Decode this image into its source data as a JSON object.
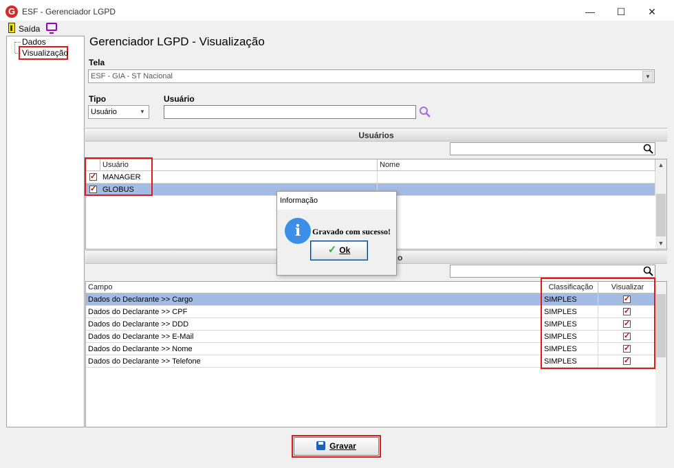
{
  "window": {
    "title": "ESF - Gerenciador LGPD",
    "logo_letter": "G",
    "minimize": "—",
    "maximize": "☐",
    "close": "✕"
  },
  "toolbar": {
    "exit_label": "Saída"
  },
  "tree": {
    "items": [
      {
        "label": "Dados"
      },
      {
        "label": "Visualização"
      }
    ]
  },
  "page": {
    "title": "Gerenciador LGPD - Visualização"
  },
  "tela": {
    "label": "Tela",
    "value": "ESF - GIA - ST Nacional"
  },
  "tipo": {
    "label": "Tipo",
    "value": "Usuário"
  },
  "usuario": {
    "label": "Usuário",
    "value": ""
  },
  "usuarios_section": {
    "title": "Usuários",
    "columns": [
      "Usuário",
      "Nome"
    ],
    "rows": [
      {
        "usuario": "MANAGER",
        "nome": "",
        "checked": true
      },
      {
        "usuario": "GLOBUS",
        "nome": "",
        "checked": true,
        "selected": true
      }
    ]
  },
  "campos_section": {
    "title": "o",
    "columns": [
      "Campo",
      "Classificação",
      "Visualizar"
    ],
    "rows": [
      {
        "campo": "Dados do Declarante >> Cargo",
        "classificacao": "SIMPLES",
        "visualizar": true,
        "selected": true
      },
      {
        "campo": "Dados do Declarante >> CPF",
        "classificacao": "SIMPLES",
        "visualizar": true
      },
      {
        "campo": "Dados do Declarante >> DDD",
        "classificacao": "SIMPLES",
        "visualizar": true
      },
      {
        "campo": "Dados do Declarante >> E-Mail",
        "classificacao": "SIMPLES",
        "visualizar": true
      },
      {
        "campo": "Dados do Declarante >> Nome",
        "classificacao": "SIMPLES",
        "visualizar": true
      },
      {
        "campo": "Dados do Declarante >> Telefone",
        "classificacao": "SIMPLES",
        "visualizar": true
      }
    ]
  },
  "dialog": {
    "title": "Informação",
    "icon": "i",
    "message": "Gravado com sucesso!",
    "ok_label": "Ok"
  },
  "footer": {
    "save_label": "Gravar"
  },
  "colors": {
    "highlight": "#e01818",
    "selection": "#a4bce4",
    "info_blue": "#3b8fe6"
  }
}
